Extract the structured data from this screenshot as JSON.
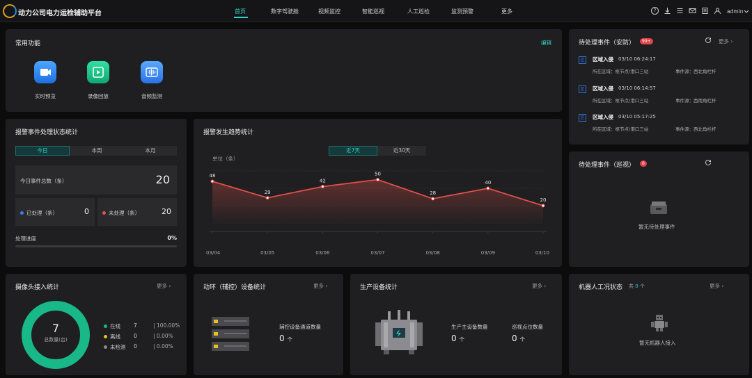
{
  "header": {
    "title": "动力公司电力运检辅助平台",
    "nav": [
      "首页",
      "数字驾驶舱",
      "视频监控",
      "智能巡视",
      "人工巡检",
      "监测预警",
      "更多"
    ],
    "active_nav": "首页",
    "user": "admin"
  },
  "common": {
    "title": "常用功能",
    "edit": "编辑",
    "items": [
      {
        "label": "实时预览",
        "icon": "video-camera-icon",
        "color": "#2b8cf3"
      },
      {
        "label": "录像回放",
        "icon": "playback-icon",
        "color": "#18c98a"
      },
      {
        "label": "音频监测",
        "icon": "audio-wave-icon",
        "color": "#3a8ef5"
      }
    ]
  },
  "alarm_status": {
    "title": "报警事件处理状态统计",
    "tabs": [
      "今日",
      "本周",
      "本月"
    ],
    "active_tab": "今日",
    "total_label": "今日事件总数（条）",
    "total_value": "20",
    "handled_label": "已处理（条）",
    "handled_value": "0",
    "unhandled_label": "未处理（条）",
    "unhandled_value": "20",
    "progress_label": "处理进度",
    "progress_value": "0%",
    "progress_fraction": 0,
    "colors": {
      "handled": "#3a7bf0",
      "unhandled": "#e0544a"
    }
  },
  "trend": {
    "title": "报警发生趋势统计",
    "tabs": [
      "近7天",
      "近30天"
    ],
    "active_tab": "近7天"
  },
  "chart_data": {
    "type": "area",
    "categories": [
      "03/04",
      "03/05",
      "03/06",
      "03/07",
      "03/08",
      "03/09",
      "03/10"
    ],
    "values": [
      48,
      29,
      42,
      50,
      28,
      40,
      20
    ],
    "labels": [
      "48",
      "29",
      "42",
      "50",
      "28",
      "40",
      "20"
    ],
    "ylabel": "单位（条）",
    "ylim": [
      0,
      60
    ],
    "grid": true,
    "color": "#e0504a"
  },
  "pending_security": {
    "title": "待处理事件（安防）",
    "badge": "99+",
    "more": "更多",
    "events": [
      {
        "title": "区域入侵",
        "time": "03/10 06:24:17",
        "area": "所在区域：枢节点/港口三站",
        "source": "事件源：西北角栏杆"
      },
      {
        "title": "区域入侵",
        "time": "03/10 06:14:57",
        "area": "所在区域：枢节点/港口三站",
        "source": "事件源：西南角栏杆"
      },
      {
        "title": "区域入侵",
        "time": "03/10 05:17:25",
        "area": "所在区域：枢节点/港口三站",
        "source": "事件源：西北角栏杆"
      }
    ]
  },
  "pending_patrol": {
    "title": "待处理事件（巡视）",
    "badge": "0",
    "empty": "暂无待处理事件"
  },
  "camera": {
    "title": "摄像头接入统计",
    "more": "更多",
    "total": "7",
    "total_label": "总数量(台)",
    "rows": [
      {
        "label": "在线",
        "count": "7",
        "pct": "100.00%",
        "color": "#18b889"
      },
      {
        "label": "离线",
        "count": "0",
        "pct": "0.00%",
        "color": "#e8c21c"
      },
      {
        "label": "未检测",
        "count": "0",
        "pct": "0.00%",
        "color": "#8a8a8a"
      }
    ],
    "online_fraction": 1.0
  },
  "aux": {
    "title": "动环（辅控）设备统计",
    "more": "更多",
    "metric_label": "辅控设备通道数量",
    "metric_value": "0",
    "metric_unit": "个"
  },
  "production": {
    "title": "生产设备统计",
    "more": "更多",
    "m1_label": "生产主设备数量",
    "m1_value": "0",
    "m1_unit": "个",
    "m2_label": "巡视点位数量",
    "m2_value": "0",
    "m2_unit": "个"
  },
  "robot": {
    "title": "机器人工况状态",
    "count_prefix": "共",
    "count": "0",
    "count_unit": "个",
    "more": "更多",
    "empty": "暂无机器人接入"
  }
}
